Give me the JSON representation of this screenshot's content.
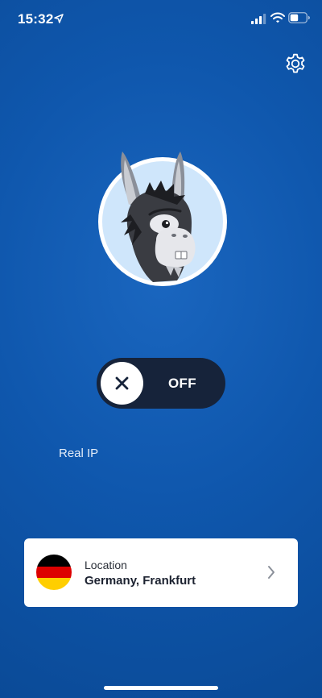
{
  "status_bar": {
    "time": "15:32"
  },
  "toggle": {
    "state_label": "OFF"
  },
  "connection": {
    "ip_label": "Real IP"
  },
  "location": {
    "caption": "Location",
    "value": "Germany, Frankfurt",
    "flag_colors": [
      "#000000",
      "#dd0000",
      "#ffce00"
    ]
  },
  "icons": {
    "settings": "gear-icon",
    "disconnect": "close-icon",
    "navigate": "chevron-right-icon",
    "location_services": "location-arrow-icon"
  },
  "colors": {
    "background": "#0f57ad",
    "toggle_bg": "#16233a",
    "card_bg": "#ffffff"
  }
}
